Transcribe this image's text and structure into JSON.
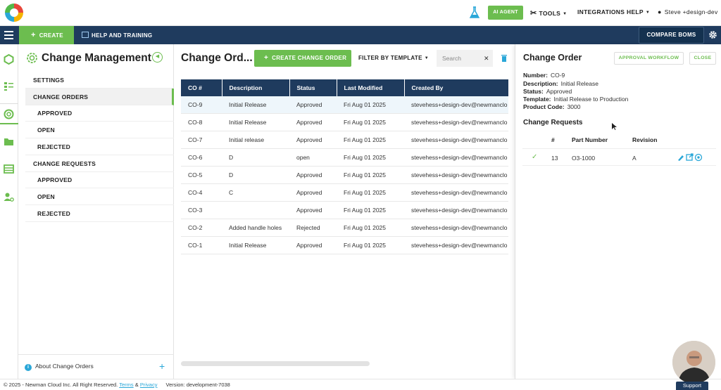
{
  "topbar": {
    "ai_agent": "AI AGENT",
    "tools": "TOOLS",
    "integrations": "INTEGRATIONS",
    "help": "HELP",
    "user": "Steve +design-dev"
  },
  "navbar": {
    "create": "CREATE",
    "help_training": "HELP AND TRAINING",
    "compare_boms": "COMPARE BOMS"
  },
  "sidebar": {
    "title": "Change Management",
    "items": [
      {
        "label": "SETTINGS"
      },
      {
        "label": "CHANGE ORDERS"
      },
      {
        "label": "APPROVED"
      },
      {
        "label": "OPEN"
      },
      {
        "label": "REJECTED"
      },
      {
        "label": "CHANGE REQUESTS"
      },
      {
        "label": "APPROVED"
      },
      {
        "label": "OPEN"
      },
      {
        "label": "REJECTED"
      }
    ],
    "about": "About Change Orders"
  },
  "main": {
    "title": "Change Ord...",
    "create_co": "CREATE CHANGE ORDER",
    "filter": "FILTER BY TEMPLATE",
    "search_placeholder": "Search",
    "columns": [
      "CO #",
      "Description",
      "Status",
      "Last Modified",
      "Created By"
    ],
    "rows": [
      {
        "co": "CO-9",
        "desc": "Initial Release",
        "status": "Approved",
        "modified": "Fri Aug 01 2025",
        "by": "stevehess+design-dev@newmanclo"
      },
      {
        "co": "CO-8",
        "desc": "Initial Release",
        "status": "Approved",
        "modified": "Fri Aug 01 2025",
        "by": "stevehess+design-dev@newmanclo"
      },
      {
        "co": "CO-7",
        "desc": "Initial release",
        "status": "Approved",
        "modified": "Fri Aug 01 2025",
        "by": "stevehess+design-dev@newmanclo"
      },
      {
        "co": "CO-6",
        "desc": "D",
        "status": "open",
        "modified": "Fri Aug 01 2025",
        "by": "stevehess+design-dev@newmanclo"
      },
      {
        "co": "CO-5",
        "desc": "D",
        "status": "Approved",
        "modified": "Fri Aug 01 2025",
        "by": "stevehess+design-dev@newmanclo"
      },
      {
        "co": "CO-4",
        "desc": "C",
        "status": "Approved",
        "modified": "Fri Aug 01 2025",
        "by": "stevehess+design-dev@newmanclo"
      },
      {
        "co": "CO-3",
        "desc": "",
        "status": "Approved",
        "modified": "Fri Aug 01 2025",
        "by": "stevehess+design-dev@newmanclo"
      },
      {
        "co": "CO-2",
        "desc": "Added handle holes",
        "status": "Rejected",
        "modified": "Fri Aug 01 2025",
        "by": "stevehess+design-dev@newmanclo"
      },
      {
        "co": "CO-1",
        "desc": "Initial Release",
        "status": "Approved",
        "modified": "Fri Aug 01 2025",
        "by": "stevehess+design-dev@newmanclo"
      }
    ]
  },
  "detail": {
    "title": "Change Order",
    "approval_workflow": "APPROVAL WORKFLOW",
    "close": "CLOSE",
    "fields": [
      {
        "label": "Number:",
        "value": "CO-9"
      },
      {
        "label": "Description:",
        "value": "Initial Release"
      },
      {
        "label": "Status:",
        "value": "Approved"
      },
      {
        "label": "Template:",
        "value": "Initial Release to Production"
      },
      {
        "label": "Product Code:",
        "value": "3000"
      }
    ],
    "change_requests_title": "Change Requests",
    "cr_columns": [
      "#",
      "Part Number",
      "Revision"
    ],
    "cr_rows": [
      {
        "num": "13",
        "part": "O3-1000",
        "rev": "A"
      }
    ]
  },
  "footer": {
    "copyright": "© 2025 - Newman Cloud Inc. All Right Reserved.",
    "terms": "Terms",
    "amp": "&",
    "privacy": "Privacy",
    "version": "Version: development-7038",
    "support": "Support"
  },
  "colors": {
    "navy": "#1f3b5e",
    "green": "#6cbd4f",
    "blue": "#2aa7d8"
  }
}
